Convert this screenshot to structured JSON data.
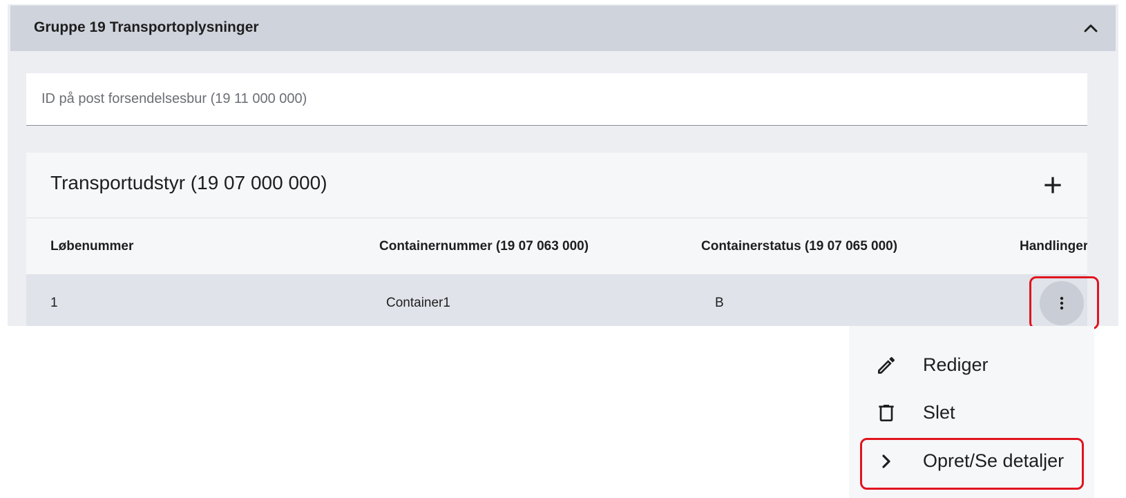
{
  "group": {
    "title": "Gruppe 19 Transportoplysninger",
    "collapse_icon": "chevron-up-icon"
  },
  "field": {
    "placeholder": "ID på post forsendelsesbur (19 11 000 000)",
    "value": ""
  },
  "table": {
    "title": "Transportudstyr (19 07 000 000)",
    "add_icon": "plus-icon",
    "columns": [
      "Løbenummer",
      "Containernummer (19 07 063 000)",
      "Containerstatus (19 07 065 000)",
      "Handlinger"
    ],
    "rows": [
      {
        "loebenummer": "1",
        "containernummer": "Container1",
        "containerstatus": "B"
      }
    ],
    "row_action_icon": "more-vertical-icon"
  },
  "menu": {
    "items": [
      {
        "label": "Rediger",
        "icon": "pencil-icon"
      },
      {
        "label": "Slet",
        "icon": "trash-icon"
      },
      {
        "label": "Opret/Se detaljer",
        "icon": "chevron-right-icon"
      }
    ]
  },
  "colors": {
    "highlight": "#e0141e",
    "panel": "#eceef2",
    "panel_header": "#cfd3db",
    "row": "#e0e3e9"
  }
}
